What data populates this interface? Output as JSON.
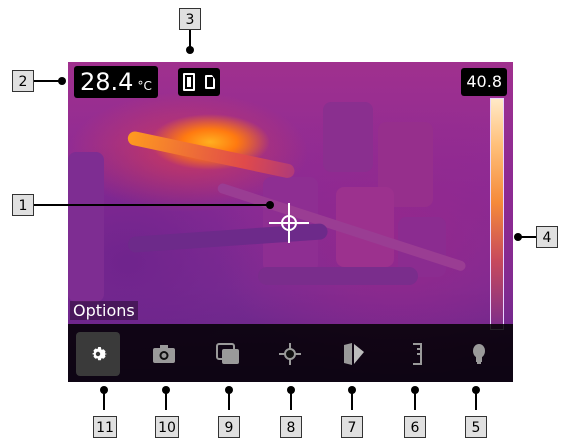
{
  "screen": {
    "spot_temperature": "28.4",
    "spot_unit": "°C",
    "scale_max": "40.8",
    "menu_label": "Options"
  },
  "menu": {
    "items": [
      {
        "icon": "gear-icon",
        "selected": true
      },
      {
        "icon": "camera-icon",
        "selected": false
      },
      {
        "icon": "image-mode-icon",
        "selected": false
      },
      {
        "icon": "measurement-spot-icon",
        "selected": false
      },
      {
        "icon": "color-palette-icon",
        "selected": false
      },
      {
        "icon": "temperature-scale-icon",
        "selected": false
      },
      {
        "icon": "lamp-icon",
        "selected": false
      }
    ]
  },
  "callouts": [
    "1",
    "2",
    "3",
    "4",
    "5",
    "6",
    "7",
    "8",
    "9",
    "10",
    "11"
  ],
  "colors": {
    "callout_bg": "#e0e0e0",
    "scale_top": "#ffe9c7",
    "scale_bottom": "#7b2c8c"
  }
}
